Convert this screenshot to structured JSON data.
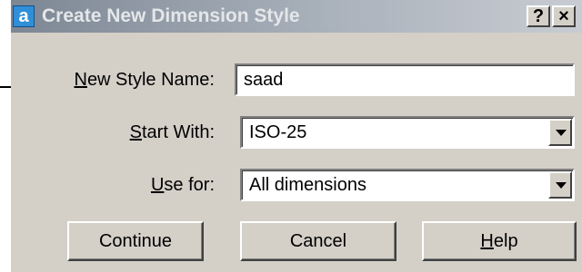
{
  "dialog": {
    "title": "Create New Dimension Style",
    "app_icon_glyph": "a",
    "help_button": "?",
    "close_button": "×"
  },
  "form": {
    "new_style_name": {
      "label_mnemonic": "N",
      "label_rest": "ew Style Name:",
      "value": "saad"
    },
    "start_with": {
      "label_mnemonic": "S",
      "label_rest": "tart With:",
      "value": "ISO-25"
    },
    "use_for": {
      "label_mnemonic": "U",
      "label_rest": "se for:",
      "value": "All dimensions"
    }
  },
  "buttons": {
    "continue": "Continue",
    "cancel": "Cancel",
    "help_mnemonic": "H",
    "help_rest": "elp"
  },
  "icons": {
    "app": "autocad-app-icon",
    "arrow": "pointer-arrow-icon"
  }
}
